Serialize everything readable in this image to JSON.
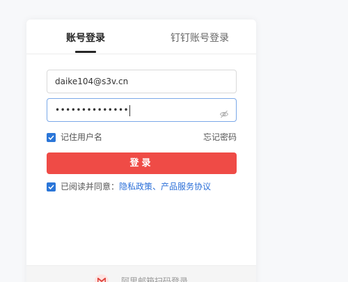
{
  "tabs": [
    {
      "label": "账号登录",
      "active": true
    },
    {
      "label": "钉钉账号登录",
      "active": false
    }
  ],
  "form": {
    "username_value": "daike104@s3v.cn",
    "password_masked": "••••••••••••••",
    "remember_label": "记住用户名",
    "remember_checked": true,
    "forgot_label": "忘记密码",
    "login_label": "登录",
    "agree_prefix": "已阅读并同意：",
    "agree_privacy": "隐私政策",
    "agree_sep": "、",
    "agree_terms": "产品服务协议",
    "agree_checked": true
  },
  "footer": {
    "text": "阿里邮箱扫码登录",
    "icon": "mail-logo-icon"
  },
  "colors": {
    "primary_red": "#ef4b46",
    "checkbox_blue": "#2b76d8",
    "link_blue": "#2b6fd8"
  }
}
